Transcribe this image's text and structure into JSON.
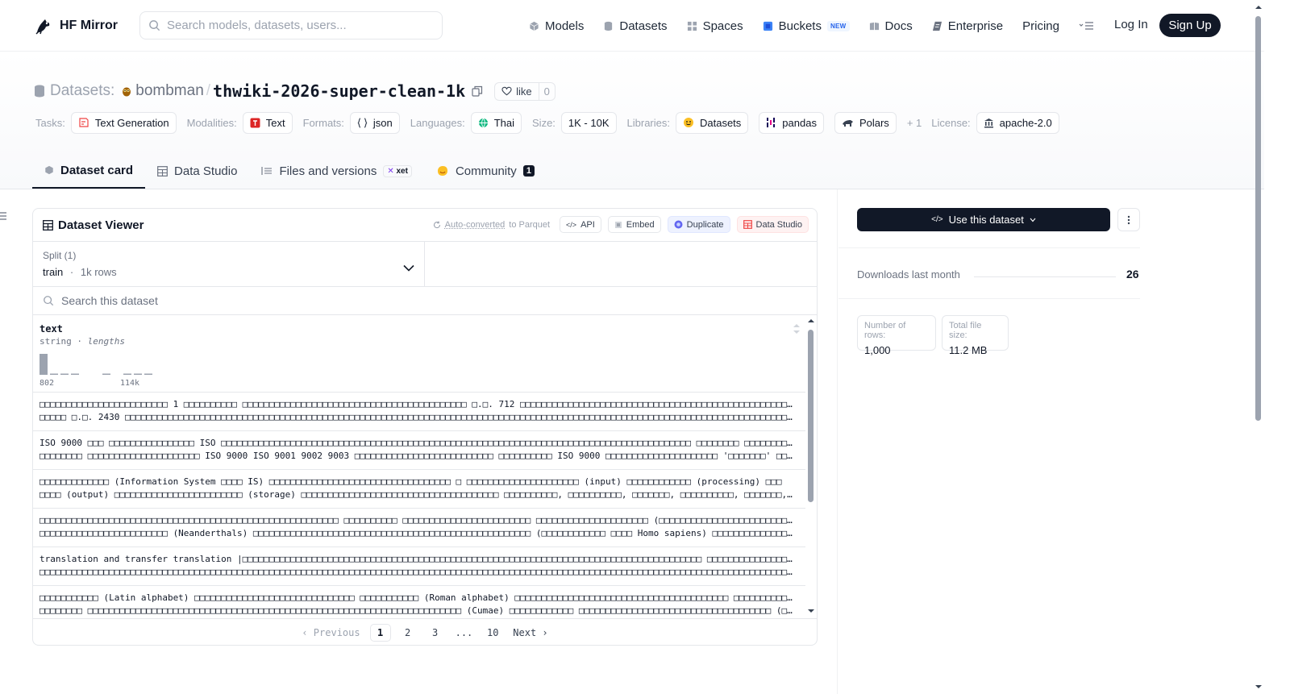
{
  "brand": {
    "name": "HF Mirror"
  },
  "search": {
    "placeholder": "Search models, datasets, users..."
  },
  "nav": {
    "models": "Models",
    "datasets": "Datasets",
    "spaces": "Spaces",
    "buckets": "Buckets",
    "buckets_badge": "NEW",
    "docs": "Docs",
    "enterprise": "Enterprise",
    "pricing": "Pricing",
    "login": "Log In",
    "signup": "Sign Up"
  },
  "header": {
    "prefix": "Datasets:",
    "owner": "bombman",
    "separator": "/",
    "name": "thwiki-2026-super-clean-1k",
    "like_label": "like",
    "like_count": "0"
  },
  "tags": {
    "tasks_label": "Tasks:",
    "task": "Text Generation",
    "modalities_label": "Modalities:",
    "modality": "Text",
    "formats_label": "Formats:",
    "format": "json",
    "languages_label": "Languages:",
    "language": "Thai",
    "size_label": "Size:",
    "size": "1K - 10K",
    "libraries_label": "Libraries:",
    "lib1": "Datasets",
    "lib2": "pandas",
    "lib3": "Polars",
    "more": "+ 1",
    "license_label": "License:",
    "license": "apache-2.0"
  },
  "tabs": {
    "card": "Dataset card",
    "studio": "Data Studio",
    "files": "Files and versions",
    "xet": "xet",
    "community": "Community",
    "community_count": "1"
  },
  "viewer": {
    "title": "Dataset Viewer",
    "auto_converted": "Auto-converted",
    "to_parquet": "to Parquet",
    "api": "API",
    "embed": "Embed",
    "duplicate": "Duplicate",
    "data_studio": "Data Studio",
    "split_label": "Split (1)",
    "split_value": "train",
    "split_dot": "·",
    "split_rows": "1k rows",
    "search_placeholder": "Search this dataset",
    "column": {
      "name": "text",
      "type": "string",
      "dot": "·",
      "stat": "lengths",
      "min": "802",
      "max": "114k",
      "histogram": [
        1.0,
        0.04,
        0.04,
        0.04,
        0.0,
        0.0,
        0.04,
        0.0,
        0.04,
        0.04,
        0.04
      ]
    },
    "rows": [
      [
        "□□□□□□□□□□□□□□□□□□□□□□□□ 1 □□□□□□□□□□ □□□□□□□□□□□□□□□□□□□□□□□□□□□□□□□□□□□□□□□□□□ □.□. 712 □□□□□□□□□□□□□□□□□□□□□□□□□□□□□□□□□□□□□□□□□□□□□□□□□□□□□□□ □□□□□□□□□□□□□□□□□",
        "□□□□□ □.□. 2430 □□□□□□□□□□□□□□□□□□□□□□□□□□□□□□□□□□□□□□□□□□□□□□□□□□□□□□□□□□□□□□□□□□□□□□□□□□□□□□□□□□□□□□□□□□□□□□□□□□□□□□□□□□□□□□□□□□□□□□□□□□□□□□□□□□□□□□□□□□□□□□"
      ],
      [
        "ISO 9000 □□□ □□□□□□□□□□□□□□□□ ISO □□□□□□□□□□□□□□□□□□□□□□□□□□□□□□□□□□□□□□□□□□□□□□□□□□□□□□□□□□□□□□□□□□□□□□□□□□□□□□□□□□□□□□□□ □□□□□□□□ □□□□□□□□□□",
        "□□□□□□□□ □□□□□□□□□□□□□□□□□□□□□ ISO 9000 ISO 9001 9002 9003 □□□□□□□□□□□□□□□□□□□□□□□□□□ □□□□□□□□□□ ISO 9000 □□□□□□□□□□□□□□□□□□□□□ '□□□□□□□' □□□□□□□□□"
      ],
      [
        "□□□□□□□□□□□□□ (Information System □□□□ IS) □□□□□□□□□□□□□□□□□□□□□□□□□□□□□□□□□□ □ □□□□□□□□□□□□□□□□□□□□□ (input) □□□□□□□□□□□□ (processing) □□□",
        "□□□□ (output) □□□□□□□□□□□□□□□□□□□□□□□□ (storage) □□□□□□□□□□□□□□□□□□□□□□□□□□□□□□□□□□□□□ □□□□□□□□□□, □□□□□□□□□□, □□□□□□□, □□□□□□□□□□, □□□□□□□, □□□□□□"
      ],
      [
        "□□□□□□□□□□□□□□□□□□□□□□□□□□□□□□□□□□□□□□□□□□□□□□□□□□□□□□□□ □□□□□□□□□□ □□□□□□□□□□□□□□□□□□□□□□□□ □□□□□□□□□□□□□□□□□□□□□ (□□□□□□□□□□□□□□□□□□□□□□□□□□□□□□□□□□) □□□",
        "□□□□□□□□□□□□□□□□□□□□□□□□ (Neanderthals) □□□□□□□□□□□□□□□□□□□□□□□□□□□□□□□□□□□□□□□□□□□□□□□□□□□□ (□□□□□□□□□□□□ □□□□ Homo sapiens) □□□□□□□□□□□□□□□□□□□□□□□□□"
      ],
      [
        "translation and transfer translation |□□□□□□□□□□□□□□□□□□□□□□□□□□□□□□□□□□□□□□□□□□□□□□□□□□□□□□□□□□□□□□□□□□□□□□□□□□□□□□□□□□□□□□ □□□□□□□□□□□□□□□□□ □□□□",
        "□□□□□□□□□□□□□□□□□□□□□□□□□□□□□□□□□□□□□□□□□□□□□□□□□□□□□□□□□□□□□□□□□□□□□□□□□□□□□□□□□□□□□□□□□□□□□□□□□□□□□□□□□□□□□□□□□□□□□□□□□□□□□□□□□□□□□□□□□□□□□□□□□□ □□□□"
      ],
      [
        "□□□□□□□□□□□ (Latin alphabet) □□□□□□□□□□□□□□□□□□□□□□□□□□□□□□ □□□□□□□□□□□ (Roman alphabet) □□□□□□□□□□□□□□□□□□□□□□□□□□□□□□□□□□□□□□□□ □□□□□□□□□□□□□□□□□□□□□□□□□□□□□□□□□□□",
        "□□□□□□□□ □□□□□□□□□□□□□□□□□□□□□□□□□□□□□□□□□□□□□□□□□□□□□□□□□□□□□□□□□□□□□□□□□□□□□□ (Cumae) □□□□□□□□□□□□ □□□□□□□□□□□□□□□□□□□□□□□□□□□□□□□□□□□□ (□□□□□□□□□"
      ]
    ],
    "pager": {
      "previous": "Previous",
      "p1": "1",
      "p2": "2",
      "p3": "3",
      "ellipsis": "...",
      "p10": "10",
      "next": "Next"
    }
  },
  "sidebar": {
    "use_button": "Use this dataset",
    "downloads_label": "Downloads last month",
    "downloads_value": "26",
    "rows_label": "Number of rows:",
    "rows_value": "1,000",
    "size_label": "Total file size:",
    "size_value": "11.2 MB"
  },
  "icons": {
    "logo": "hf-logo-icon",
    "search": "search-icon",
    "models": "cube-icon",
    "datasets": "database-icon",
    "spaces": "grid-icon",
    "buckets": "bucket-icon",
    "docs": "book-icon",
    "enterprise": "enterprise-icon",
    "menu": "menu-icon",
    "copy": "copy-icon",
    "heart": "heart-icon",
    "owner_avatar": "owl-avatar-icon"
  },
  "colors": {
    "primary_dark": "#111827",
    "muted": "#9ca3af",
    "border": "#e5e7eb",
    "new_badge": "#2563eb",
    "histogram": "#9ca3af"
  }
}
